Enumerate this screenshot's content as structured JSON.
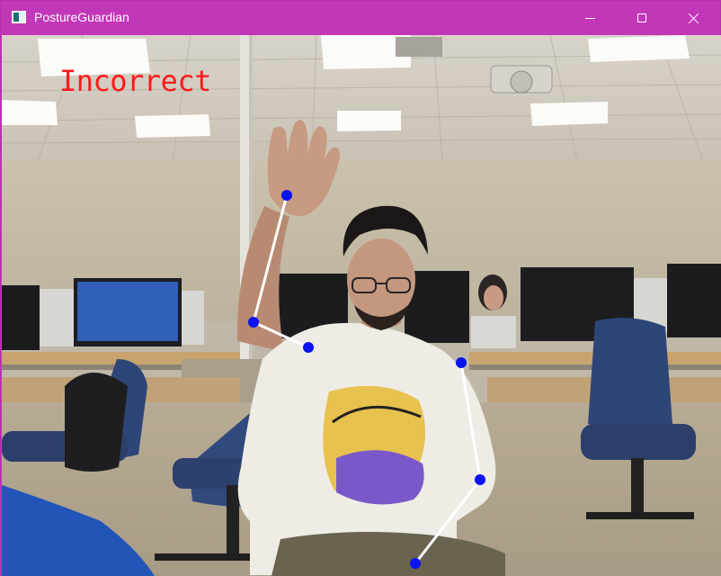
{
  "window": {
    "title": "PostureGuardian",
    "accent_color": "#c236b8",
    "icons": {
      "app": "app-window-icon",
      "minimize": "minimize-icon",
      "maximize": "maximize-icon",
      "close": "close-icon"
    }
  },
  "camera": {
    "posture_status": "Incorrect",
    "status_color": "#ff1a1a",
    "skeleton_line_color": "#ffffff",
    "keypoint_color": "#0a14f0"
  }
}
